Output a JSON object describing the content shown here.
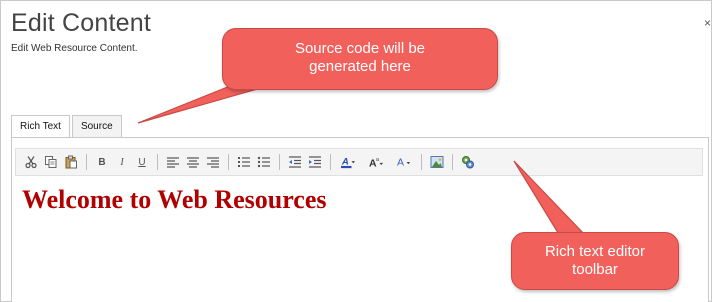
{
  "dialog": {
    "title": "Edit Content",
    "subtitle": "Edit Web Resource Content.",
    "close_glyph": "×"
  },
  "tabs": [
    {
      "label": "Rich Text"
    },
    {
      "label": "Source"
    }
  ],
  "toolbar": {
    "buttons": [
      {
        "name": "cut-icon"
      },
      {
        "name": "copy-icon"
      },
      {
        "name": "paste-icon"
      },
      {
        "name": "bold-icon",
        "glyph": "B"
      },
      {
        "name": "italic-icon",
        "glyph": "I"
      },
      {
        "name": "underline-icon",
        "glyph": "U"
      },
      {
        "name": "align-left-icon"
      },
      {
        "name": "align-center-icon"
      },
      {
        "name": "align-right-icon"
      },
      {
        "name": "numbered-list-icon"
      },
      {
        "name": "bulleted-list-icon"
      },
      {
        "name": "decrease-indent-icon"
      },
      {
        "name": "increase-indent-icon"
      },
      {
        "name": "highlight-color-icon"
      },
      {
        "name": "font-size-icon"
      },
      {
        "name": "font-color-icon"
      },
      {
        "name": "insert-image-icon"
      },
      {
        "name": "insert-link-icon"
      }
    ]
  },
  "editor": {
    "content_heading": "Welcome to Web Resources"
  },
  "callouts": {
    "source": {
      "line1": "Source code will be",
      "line2": "generated here"
    },
    "toolbar": {
      "line1": "Rich text editor",
      "line2": "toolbar"
    }
  },
  "colors": {
    "heading": "#b00000",
    "callout_fill": "#f2605b",
    "callout_border": "#c84a45",
    "toolbar_bg": "#f4f4f4"
  }
}
